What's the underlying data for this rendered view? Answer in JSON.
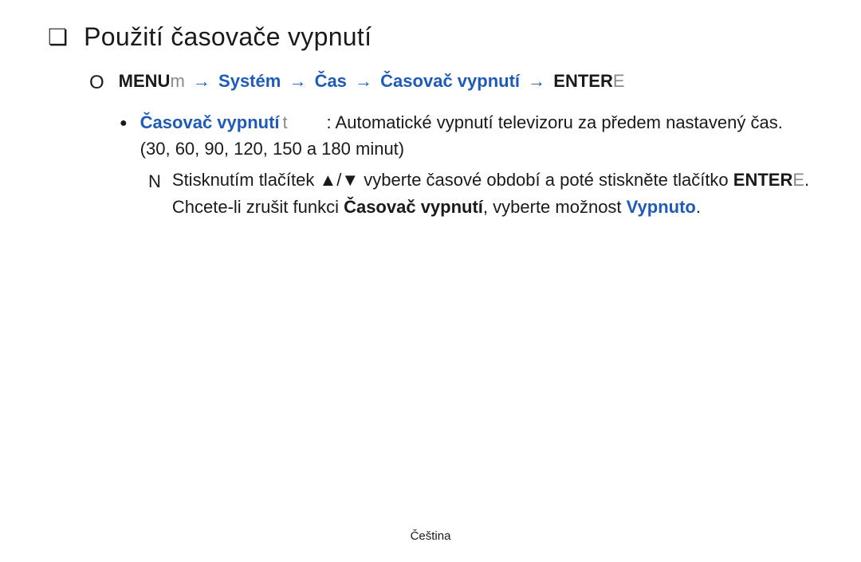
{
  "title": "Použití časovače vypnutí",
  "breadcrumb": {
    "menu_label": "MENU",
    "menu_suffix": "m",
    "items": [
      "Systém",
      "Čas",
      "Časovač vypnutí"
    ],
    "enter_label": "ENTER",
    "enter_suffix": "E",
    "arrow": "→"
  },
  "bullet": {
    "heading": "Časovač vypnutí",
    "heading_suffix": "t",
    "desc_1": ": Automatické vypnutí televizoru za předem nastavený čas. (30, 60, 90, 120, 150 a 180 minut)"
  },
  "note": {
    "marker": "N",
    "text_1": "Stisknutím tlačítek ▲/▼ vyberte časové období a poté stiskněte tlačítko",
    "enter_label": "ENTER",
    "enter_suffix": "E",
    "text_2": ". Chcete-li zrušit funkci ",
    "func_name": "Časovač vypnutí",
    "text_3": ", vyberte možnost ",
    "off_label": "Vypnuto",
    "period": "."
  },
  "footer": "Čeština"
}
